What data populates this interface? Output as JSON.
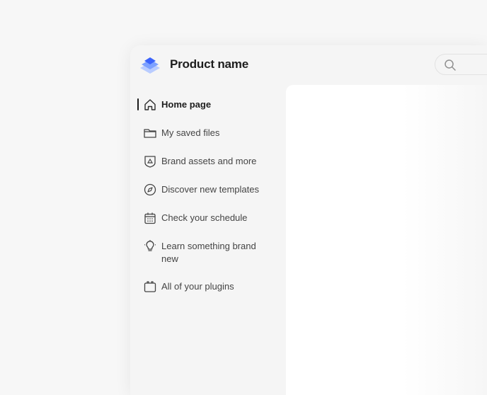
{
  "app": {
    "product_name": "Product name",
    "brand_colors": {
      "logo_dark": "#3b63fb",
      "logo_mid": "#7da1ff",
      "logo_light": "#b9ccff"
    }
  },
  "header": {
    "search": {
      "icon": "search-icon"
    }
  },
  "nav": {
    "items": [
      {
        "label": "Home page",
        "icon": "home-icon",
        "active": true
      },
      {
        "label": "My saved files",
        "icon": "folder-icon",
        "active": false
      },
      {
        "label": "Brand assets and more",
        "icon": "brand-shield-icon",
        "active": false
      },
      {
        "label": "Discover new templates",
        "icon": "compass-icon",
        "active": false
      },
      {
        "label": "Check your schedule",
        "icon": "calendar-icon",
        "active": false
      },
      {
        "label": "Learn something brand new",
        "icon": "lightbulb-icon",
        "active": false
      },
      {
        "label": "All of your plugins",
        "icon": "plugin-icon",
        "active": false
      }
    ]
  }
}
